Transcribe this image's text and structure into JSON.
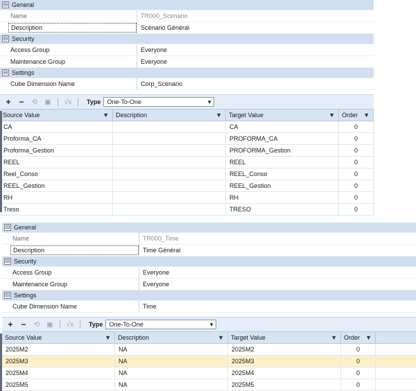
{
  "panel1": {
    "sections": {
      "general": "General",
      "security": "Security",
      "settings": "Settings"
    },
    "props": {
      "name_label": "Name",
      "name_value": "TR000_Scenario",
      "description_label": "Description",
      "description_value": "Scénario Général",
      "access_label": "Access Group",
      "access_value": "Everyone",
      "maint_label": "Maintenance Group",
      "maint_value": "Everyone",
      "cube_label": "Cube Dimension Name",
      "cube_value": "Corp_Scenario"
    },
    "toolbar": {
      "type_label": "Type",
      "type_value": "One-To-One"
    },
    "columns": [
      "Source Value",
      "Description",
      "Target Value",
      "Order"
    ],
    "rows": [
      [
        "CA",
        "",
        "CA",
        "0"
      ],
      [
        "Proforma_CA",
        "",
        "PROFORMA_CA",
        "0"
      ],
      [
        "Proforma_Gestion",
        "",
        "PROFORMA_Gestion",
        "0"
      ],
      [
        "REEL",
        "",
        "REEL",
        "0"
      ],
      [
        "Reel_Conso",
        "",
        "REEL_Conso",
        "0"
      ],
      [
        "REEL_Gestion",
        "",
        "REEL_Gestion",
        "0"
      ],
      [
        "RH",
        "",
        "RH",
        "0"
      ],
      [
        "Treso",
        "",
        "TRESO",
        "0"
      ]
    ]
  },
  "panel2": {
    "sections": {
      "general": "General",
      "security": "Security",
      "settings": "Settings"
    },
    "props": {
      "name_label": "Name",
      "name_value": "TR000_Time",
      "description_label": "Description",
      "description_value": "Time Général",
      "access_label": "Access Group",
      "access_value": "Everyone",
      "maint_label": "Maintenance Group",
      "maint_value": "Everyone",
      "cube_label": "Cube Dimension Name",
      "cube_value": "Time"
    },
    "toolbar": {
      "type_label": "Type",
      "type_value": "One-To-One"
    },
    "columns": [
      "Source Value",
      "Description",
      "Target Value",
      "Order"
    ],
    "rows": [
      [
        "2025M2",
        "NA",
        "2025M2",
        "0"
      ],
      [
        "2025M3",
        "NA",
        "2025M3",
        "0"
      ],
      [
        "2025M4",
        "NA",
        "2025M4",
        "0"
      ],
      [
        "2025M5",
        "NA",
        "2025M5",
        "0"
      ]
    ],
    "selected_row": 1
  },
  "icons": {
    "add": "+",
    "remove": "−",
    "refresh": "⟲",
    "save": "▣",
    "formula": "√x",
    "dropdown": "▾",
    "filter": "▼"
  }
}
